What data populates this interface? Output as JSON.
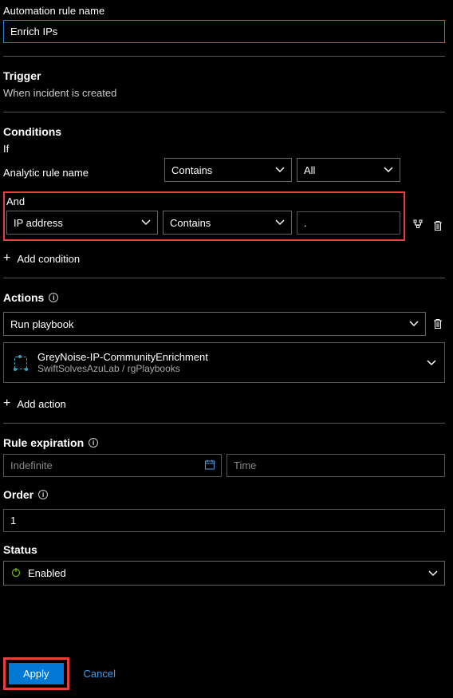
{
  "ruleName": {
    "label": "Automation rule name",
    "value": "Enrich IPs"
  },
  "trigger": {
    "title": "Trigger",
    "text": "When incident is created"
  },
  "conditions": {
    "title": "Conditions",
    "ifLabel": "If",
    "analyticRuleLabel": "Analytic rule name",
    "operator1": "Contains",
    "value1": "All",
    "andLabel": "And",
    "field2": "IP address",
    "operator2": "Contains",
    "value2": ".",
    "addCondition": "Add condition"
  },
  "actions": {
    "title": "Actions",
    "actionType": "Run playbook",
    "playbookName": "GreyNoise-IP-CommunityEnrichment",
    "playbookSub": "SwiftSolvesAzuLab / rgPlaybooks",
    "addAction": "Add action"
  },
  "expiration": {
    "title": "Rule expiration",
    "datePlaceholder": "Indefinite",
    "timePlaceholder": "Time"
  },
  "order": {
    "title": "Order",
    "value": "1"
  },
  "status": {
    "title": "Status",
    "value": "Enabled"
  },
  "footer": {
    "apply": "Apply",
    "cancel": "Cancel"
  }
}
